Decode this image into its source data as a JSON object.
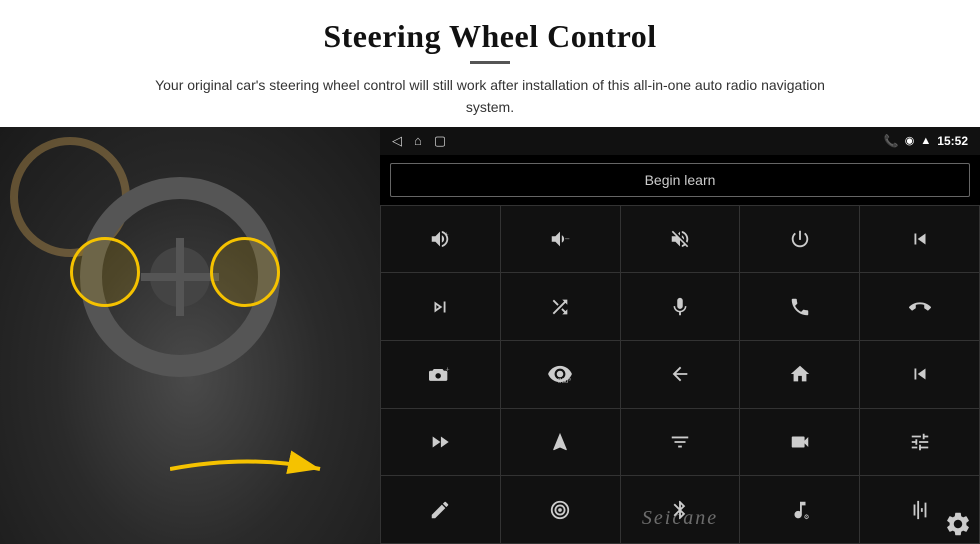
{
  "page": {
    "title": "Steering Wheel Control",
    "divider": true,
    "subtitle": "Your original car's steering wheel control will still work after installation of this all-in-one auto radio navigation system."
  },
  "status_bar": {
    "time": "15:52",
    "back_label": "◁",
    "home_label": "⌂",
    "square_label": "▢"
  },
  "begin_learn_button": "Begin learn",
  "controls": [
    {
      "id": "vol-up",
      "icon": "vol_up"
    },
    {
      "id": "vol-down",
      "icon": "vol_down"
    },
    {
      "id": "mute",
      "icon": "mute"
    },
    {
      "id": "power",
      "icon": "power"
    },
    {
      "id": "prev-track-phone",
      "icon": "prev_phone"
    },
    {
      "id": "skip-fwd",
      "icon": "skip_fwd"
    },
    {
      "id": "shuffle",
      "icon": "shuffle"
    },
    {
      "id": "mic",
      "icon": "mic"
    },
    {
      "id": "phone",
      "icon": "phone"
    },
    {
      "id": "hang-up",
      "icon": "hang_up"
    },
    {
      "id": "car-horn",
      "icon": "car_horn"
    },
    {
      "id": "360-view",
      "icon": "three_sixty"
    },
    {
      "id": "back",
      "icon": "back_arrow"
    },
    {
      "id": "home",
      "icon": "home"
    },
    {
      "id": "skip-back",
      "icon": "skip_back2"
    },
    {
      "id": "skip-fwd2",
      "icon": "skip_fwd2"
    },
    {
      "id": "navigate",
      "icon": "navigate"
    },
    {
      "id": "equalizer",
      "icon": "equalizer"
    },
    {
      "id": "camera",
      "icon": "camera"
    },
    {
      "id": "settings2",
      "icon": "sliders"
    },
    {
      "id": "pen",
      "icon": "pen"
    },
    {
      "id": "radio",
      "icon": "radio"
    },
    {
      "id": "bluetooth",
      "icon": "bluetooth"
    },
    {
      "id": "music-note",
      "icon": "music_note"
    },
    {
      "id": "waveform",
      "icon": "waveform"
    }
  ],
  "watermark": "Seicane",
  "gear_icon": "gear"
}
